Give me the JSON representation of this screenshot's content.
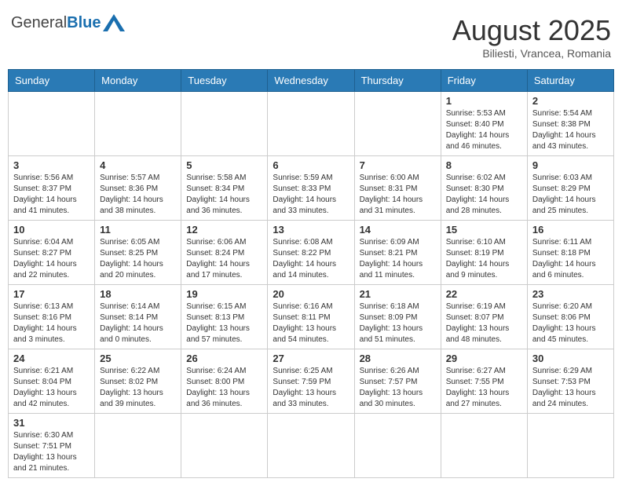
{
  "header": {
    "logo_general": "General",
    "logo_blue": "Blue",
    "month_title": "August 2025",
    "subtitle": "Biliesti, Vrancea, Romania"
  },
  "weekdays": [
    "Sunday",
    "Monday",
    "Tuesday",
    "Wednesday",
    "Thursday",
    "Friday",
    "Saturday"
  ],
  "weeks": [
    [
      {
        "day": "",
        "info": ""
      },
      {
        "day": "",
        "info": ""
      },
      {
        "day": "",
        "info": ""
      },
      {
        "day": "",
        "info": ""
      },
      {
        "day": "",
        "info": ""
      },
      {
        "day": "1",
        "info": "Sunrise: 5:53 AM\nSunset: 8:40 PM\nDaylight: 14 hours and 46 minutes."
      },
      {
        "day": "2",
        "info": "Sunrise: 5:54 AM\nSunset: 8:38 PM\nDaylight: 14 hours and 43 minutes."
      }
    ],
    [
      {
        "day": "3",
        "info": "Sunrise: 5:56 AM\nSunset: 8:37 PM\nDaylight: 14 hours and 41 minutes."
      },
      {
        "day": "4",
        "info": "Sunrise: 5:57 AM\nSunset: 8:36 PM\nDaylight: 14 hours and 38 minutes."
      },
      {
        "day": "5",
        "info": "Sunrise: 5:58 AM\nSunset: 8:34 PM\nDaylight: 14 hours and 36 minutes."
      },
      {
        "day": "6",
        "info": "Sunrise: 5:59 AM\nSunset: 8:33 PM\nDaylight: 14 hours and 33 minutes."
      },
      {
        "day": "7",
        "info": "Sunrise: 6:00 AM\nSunset: 8:31 PM\nDaylight: 14 hours and 31 minutes."
      },
      {
        "day": "8",
        "info": "Sunrise: 6:02 AM\nSunset: 8:30 PM\nDaylight: 14 hours and 28 minutes."
      },
      {
        "day": "9",
        "info": "Sunrise: 6:03 AM\nSunset: 8:29 PM\nDaylight: 14 hours and 25 minutes."
      }
    ],
    [
      {
        "day": "10",
        "info": "Sunrise: 6:04 AM\nSunset: 8:27 PM\nDaylight: 14 hours and 22 minutes."
      },
      {
        "day": "11",
        "info": "Sunrise: 6:05 AM\nSunset: 8:25 PM\nDaylight: 14 hours and 20 minutes."
      },
      {
        "day": "12",
        "info": "Sunrise: 6:06 AM\nSunset: 8:24 PM\nDaylight: 14 hours and 17 minutes."
      },
      {
        "day": "13",
        "info": "Sunrise: 6:08 AM\nSunset: 8:22 PM\nDaylight: 14 hours and 14 minutes."
      },
      {
        "day": "14",
        "info": "Sunrise: 6:09 AM\nSunset: 8:21 PM\nDaylight: 14 hours and 11 minutes."
      },
      {
        "day": "15",
        "info": "Sunrise: 6:10 AM\nSunset: 8:19 PM\nDaylight: 14 hours and 9 minutes."
      },
      {
        "day": "16",
        "info": "Sunrise: 6:11 AM\nSunset: 8:18 PM\nDaylight: 14 hours and 6 minutes."
      }
    ],
    [
      {
        "day": "17",
        "info": "Sunrise: 6:13 AM\nSunset: 8:16 PM\nDaylight: 14 hours and 3 minutes."
      },
      {
        "day": "18",
        "info": "Sunrise: 6:14 AM\nSunset: 8:14 PM\nDaylight: 14 hours and 0 minutes."
      },
      {
        "day": "19",
        "info": "Sunrise: 6:15 AM\nSunset: 8:13 PM\nDaylight: 13 hours and 57 minutes."
      },
      {
        "day": "20",
        "info": "Sunrise: 6:16 AM\nSunset: 8:11 PM\nDaylight: 13 hours and 54 minutes."
      },
      {
        "day": "21",
        "info": "Sunrise: 6:18 AM\nSunset: 8:09 PM\nDaylight: 13 hours and 51 minutes."
      },
      {
        "day": "22",
        "info": "Sunrise: 6:19 AM\nSunset: 8:07 PM\nDaylight: 13 hours and 48 minutes."
      },
      {
        "day": "23",
        "info": "Sunrise: 6:20 AM\nSunset: 8:06 PM\nDaylight: 13 hours and 45 minutes."
      }
    ],
    [
      {
        "day": "24",
        "info": "Sunrise: 6:21 AM\nSunset: 8:04 PM\nDaylight: 13 hours and 42 minutes."
      },
      {
        "day": "25",
        "info": "Sunrise: 6:22 AM\nSunset: 8:02 PM\nDaylight: 13 hours and 39 minutes."
      },
      {
        "day": "26",
        "info": "Sunrise: 6:24 AM\nSunset: 8:00 PM\nDaylight: 13 hours and 36 minutes."
      },
      {
        "day": "27",
        "info": "Sunrise: 6:25 AM\nSunset: 7:59 PM\nDaylight: 13 hours and 33 minutes."
      },
      {
        "day": "28",
        "info": "Sunrise: 6:26 AM\nSunset: 7:57 PM\nDaylight: 13 hours and 30 minutes."
      },
      {
        "day": "29",
        "info": "Sunrise: 6:27 AM\nSunset: 7:55 PM\nDaylight: 13 hours and 27 minutes."
      },
      {
        "day": "30",
        "info": "Sunrise: 6:29 AM\nSunset: 7:53 PM\nDaylight: 13 hours and 24 minutes."
      }
    ],
    [
      {
        "day": "31",
        "info": "Sunrise: 6:30 AM\nSunset: 7:51 PM\nDaylight: 13 hours and 21 minutes."
      },
      {
        "day": "",
        "info": ""
      },
      {
        "day": "",
        "info": ""
      },
      {
        "day": "",
        "info": ""
      },
      {
        "day": "",
        "info": ""
      },
      {
        "day": "",
        "info": ""
      },
      {
        "day": "",
        "info": ""
      }
    ]
  ]
}
